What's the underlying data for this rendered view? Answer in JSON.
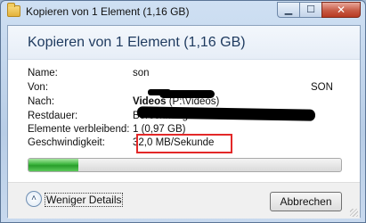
{
  "window": {
    "title": "Kopieren von 1 Element (1,16 GB)",
    "close_glyph": "✕",
    "minimize_glyph": "▁",
    "maximize_glyph": "☐"
  },
  "header": {
    "text": "Kopieren von 1 Element (1,16 GB)"
  },
  "details": {
    "name_label": "Name:",
    "name_value": "son",
    "von_label": "Von:",
    "von_value": "SON",
    "nach_label": "Nach:",
    "nach_value_bold": "Videos",
    "nach_value_rest": " (P:\\Videos)",
    "restdauer_label": "Restdauer:",
    "restdauer_value": "Berechnung...",
    "elemente_label": "Elemente verbleibend:",
    "elemente_value": "1 (0,97 GB)",
    "speed_label": "Geschwindigkeit:",
    "speed_value": "32,0 MB/Sekunde"
  },
  "progress": {
    "fraction": 0.16,
    "color": "#3bb33c"
  },
  "footer": {
    "details_toggle_label": "Weniger Details",
    "details_toggle_glyph": "˄",
    "cancel_label": "Abbrechen"
  },
  "icons": [
    "copy-folder-icon",
    "chevron-up-icon"
  ],
  "colors": {
    "highlight_border": "#e32828",
    "header_text": "#1e3a5f"
  }
}
